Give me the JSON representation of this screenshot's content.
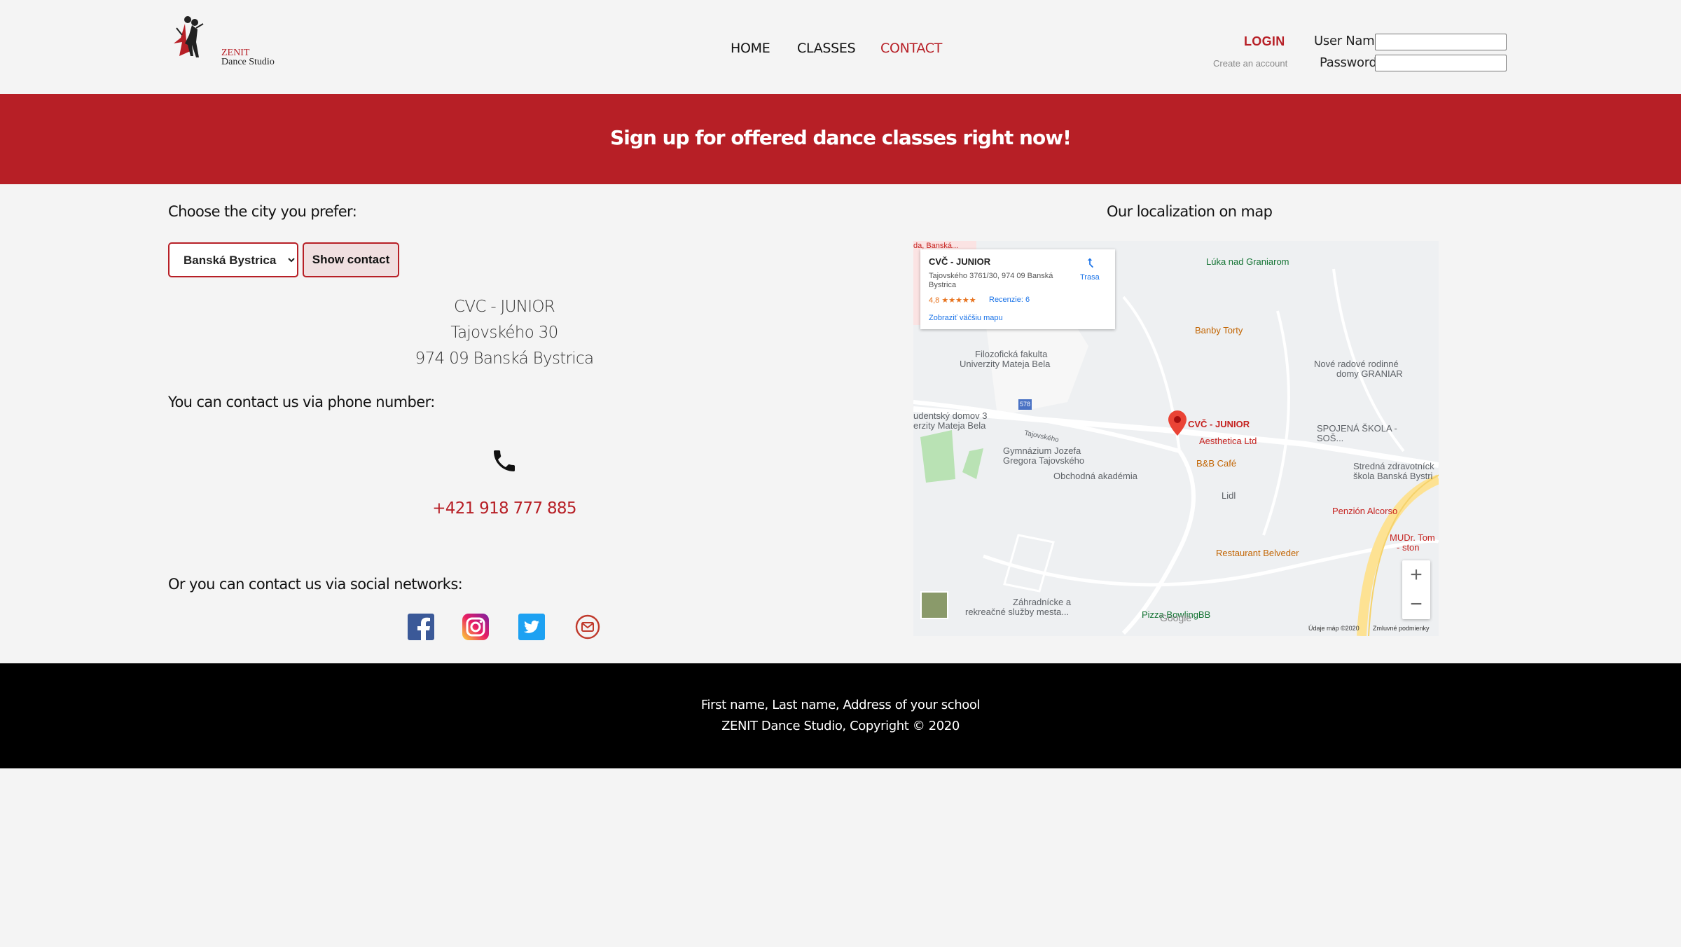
{
  "header": {
    "logo_line1": "ZENIT",
    "logo_line2": "Dance Studio",
    "nav": [
      "HOME",
      "CLASSES",
      "CONTACT"
    ],
    "active_nav": "CONTACT",
    "login": {
      "title": "LOGIN",
      "create_account": "Create an account",
      "user_label": "User Name",
      "password_label": "Password",
      "user_value": "",
      "password_value": ""
    }
  },
  "banner": {
    "text": "Sign up for offered dance classes right now!"
  },
  "contact": {
    "city_heading": "Choose the city you prefer:",
    "city_selected": "Banská Bystrica",
    "show_button": "Show contact",
    "address": [
      "CVC - JUNIOR",
      "Tajovského 30",
      "974 09 Banská Bystrica"
    ],
    "phone_heading": "You can contact us via phone number:",
    "phone": "+421 918 777 885",
    "social_heading": "Or you can contact us via social networks:",
    "social_icons": [
      "facebook-icon",
      "instagram-icon",
      "twitter-icon",
      "mail-icon"
    ]
  },
  "map": {
    "heading": "Our localization on map",
    "card": {
      "title": "CVČ - JUNIOR",
      "address": "Tajovského 3761/30, 974 09 Banská Bystrica",
      "rating": "4,8 ★★★★★",
      "reviews": "Recenzie: 6",
      "route": "Trasa",
      "bigger_map": "Zobraziť väčšiu mapu"
    },
    "labels": {
      "luka": "Lúka nad Graniarom",
      "banby": "Banby Torty",
      "filozoficka1": "Filozofická fakulta",
      "filozoficka2": "Univerzity Mateja Bela",
      "nove1": "Nové radové rodinné",
      "nove2": "domy GRANIAR",
      "studentsky1": "udentský domov 3",
      "studentsky2": "erzity Mateja Bela",
      "cvc": "CVČ - JUNIOR",
      "aesthetica": "Aesthetica Ltd",
      "spojena1": "SPOJENÁ ŠKOLA -",
      "spojena2": "SOŠ...",
      "gymnazium1": "Gymnázium Jozefa",
      "gymnazium2": "Gregora Tajovského",
      "bb_cafe": "B&B Café",
      "obchodna": "Obchodná akadémia",
      "stredna1": "Stredná zdravotníck",
      "stredna2": "škola Banská Bystri",
      "lidl": "Lidl",
      "penzion": "Penzión Alcorso",
      "restaurant": "Restaurant Belveder",
      "mudr1": "MUDr. Tom",
      "mudr2": "- ston",
      "zahradnicke1": "Záhradnícke a",
      "zahradnicke2": "rekreačné služby mesta...",
      "pizza": "Pizza BowlingBB",
      "road": "578",
      "tajovskeho_street": "Tajovského",
      "da_banska": "da, Banská..."
    },
    "google": "Google",
    "data_label": "Údaje máp ©2020",
    "terms": "Zmluvné podmienky",
    "zoom_in": "+",
    "zoom_out": "−"
  },
  "footer": {
    "line1": "First name, Last name, Address of your school",
    "line2": "ZENIT Dance Studio, Copyright © 2020"
  },
  "colors": {
    "brand_red": "#b71f26",
    "footer_bg": "#000000",
    "page_bg": "#f4f4f4"
  }
}
